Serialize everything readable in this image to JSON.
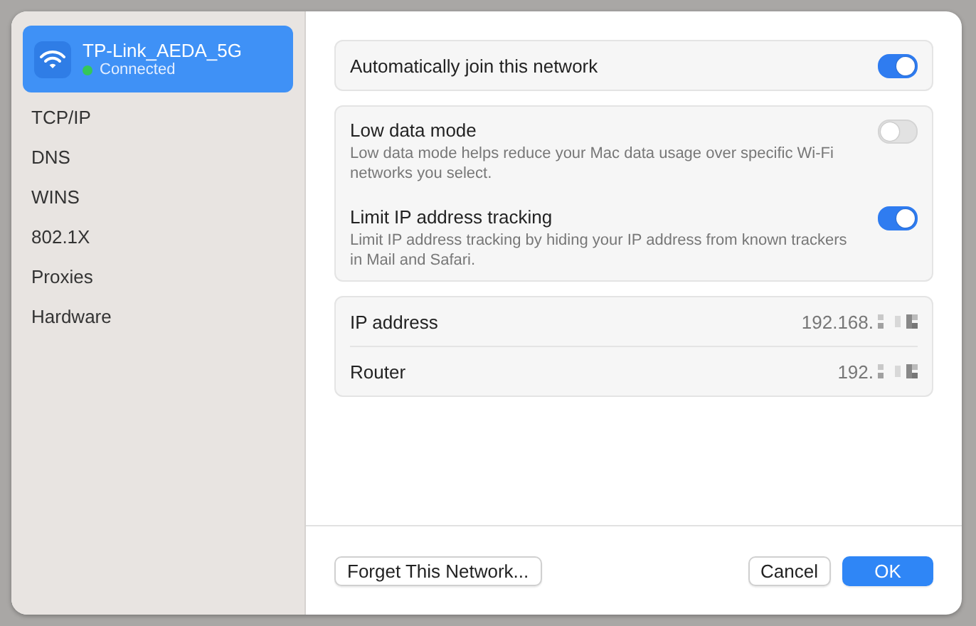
{
  "sidebar": {
    "network": {
      "name": "TP-Link_AEDA_5G",
      "status": "Connected",
      "color": "#34c759",
      "selected": true
    },
    "items": [
      {
        "label": "TCP/IP",
        "selected": false
      },
      {
        "label": "DNS",
        "selected": false
      },
      {
        "label": "WINS",
        "selected": false
      },
      {
        "label": "802.1X",
        "selected": false
      },
      {
        "label": "Proxies",
        "selected": false
      },
      {
        "label": "Hardware",
        "selected": false
      }
    ]
  },
  "groups": [
    {
      "rows": [
        {
          "kind": "toggle",
          "label": "Automatically join this network",
          "on": true
        }
      ]
    },
    {
      "rows": [
        {
          "kind": "toggle",
          "label": "Low data mode",
          "description": "Low data mode helps reduce your Mac data usage over specific Wi-Fi networks you select.",
          "on": false
        },
        {
          "kind": "toggle",
          "label": "Limit IP address tracking",
          "description": "Limit IP address tracking by hiding your IP address from known trackers in Mail and Safari.",
          "on": true
        }
      ]
    },
    {
      "rows": [
        {
          "kind": "value",
          "label": "IP address",
          "value": "192.168.",
          "redacted": true
        },
        {
          "kind": "value",
          "label": "Router",
          "value": "192.",
          "redacted": true
        }
      ]
    }
  ],
  "buttons": [
    {
      "label": "Forget This Network...",
      "kind": "secondary"
    },
    {
      "label": "Cancel",
      "kind": "secondary"
    },
    {
      "label": "OK",
      "kind": "primary"
    }
  ]
}
